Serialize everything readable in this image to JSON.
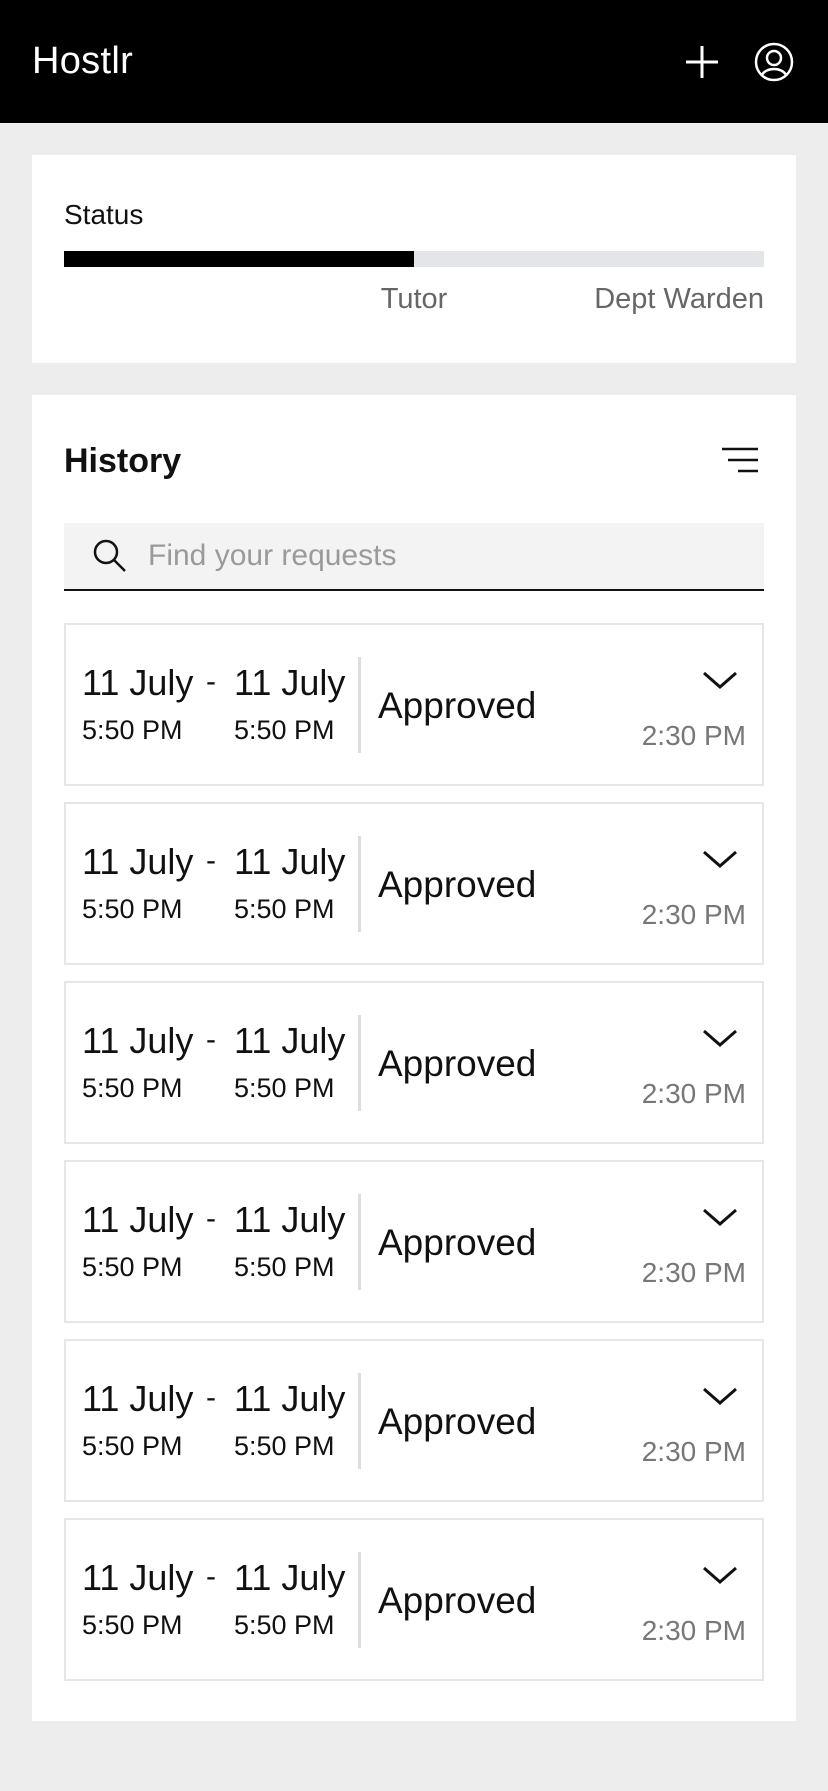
{
  "app": {
    "title": "Hostlr"
  },
  "status": {
    "title": "Status",
    "progress": 0.5,
    "steps": [
      "Tutor",
      "Dept Warden"
    ]
  },
  "history": {
    "title": "History",
    "search": {
      "placeholder": "Find your requests",
      "value": ""
    },
    "items": [
      {
        "from_date": "11 July",
        "from_time": "5:50 PM",
        "to_date": "11 July",
        "to_time": "5:50 PM",
        "status": "Approved",
        "time": "2:30 PM"
      },
      {
        "from_date": "11 July",
        "from_time": "5:50 PM",
        "to_date": "11 July",
        "to_time": "5:50 PM",
        "status": "Approved",
        "time": "2:30 PM"
      },
      {
        "from_date": "11 July",
        "from_time": "5:50 PM",
        "to_date": "11 July",
        "to_time": "5:50 PM",
        "status": "Approved",
        "time": "2:30 PM"
      },
      {
        "from_date": "11 July",
        "from_time": "5:50 PM",
        "to_date": "11 July",
        "to_time": "5:50 PM",
        "status": "Approved",
        "time": "2:30 PM"
      },
      {
        "from_date": "11 July",
        "from_time": "5:50 PM",
        "to_date": "11 July",
        "to_time": "5:50 PM",
        "status": "Approved",
        "time": "2:30 PM"
      },
      {
        "from_date": "11 July",
        "from_time": "5:50 PM",
        "to_date": "11 July",
        "to_time": "5:50 PM",
        "status": "Approved",
        "time": "2:30 PM"
      }
    ]
  },
  "icons": {
    "add": "plus-icon",
    "profile": "user-circle-icon",
    "filter": "filter-lines-icon",
    "search": "search-icon",
    "expand": "chevron-down-icon"
  },
  "colors": {
    "header_bg": "#000000",
    "progress_fill": "#000000",
    "progress_track": "#e3e5e9"
  }
}
